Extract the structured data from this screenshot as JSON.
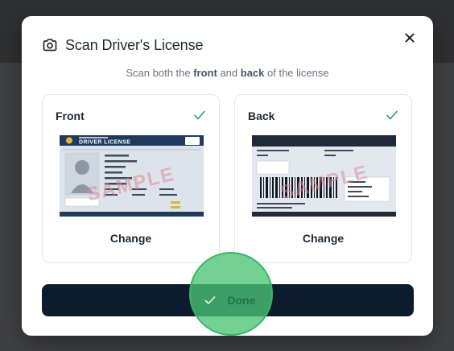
{
  "modal": {
    "title": "Scan Driver's License",
    "subtitle": {
      "part1": "Scan both the ",
      "front": "front",
      "part2": " and ",
      "back": "back",
      "part3": " of the license"
    }
  },
  "cards": {
    "front": {
      "label": "Front",
      "change_label": "Change",
      "image": {
        "header": "DRIVER LICENSE",
        "watermark": "SAMPLE"
      }
    },
    "back": {
      "label": "Back",
      "change_label": "Change",
      "image": {
        "watermark": "SAMPLE"
      }
    }
  },
  "actions": {
    "done_label": "Done"
  },
  "colors": {
    "primary": "#0d1b2e",
    "success": "#22a55a",
    "highlight": "#4ac474"
  },
  "icons": {
    "camera": "camera-icon",
    "close": "close-icon",
    "check": "check-icon"
  }
}
